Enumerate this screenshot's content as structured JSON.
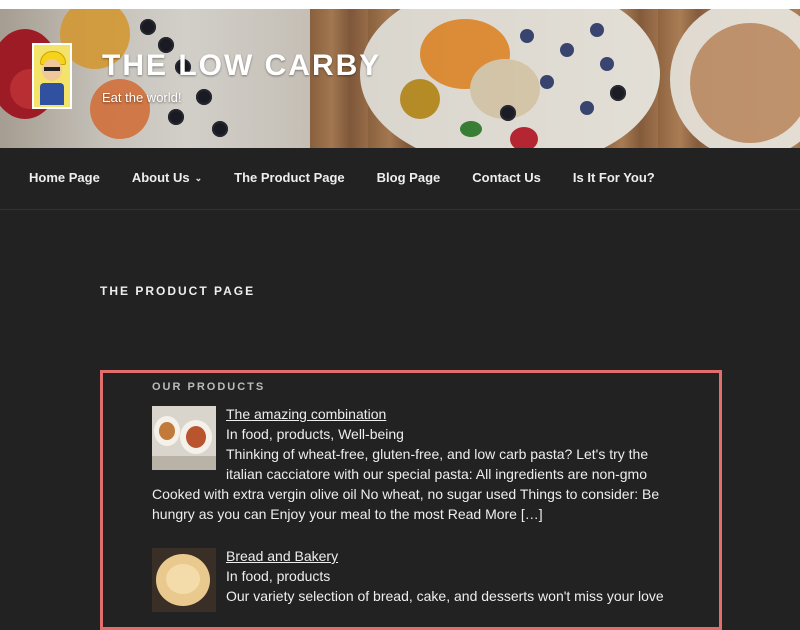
{
  "site": {
    "title": "THE LOW CARBY",
    "tagline": "Eat the world!"
  },
  "nav": {
    "items": [
      {
        "label": "Home Page"
      },
      {
        "label": "About Us"
      },
      {
        "label": "The Product Page"
      },
      {
        "label": "Blog Page"
      },
      {
        "label": "Contact Us"
      },
      {
        "label": "Is It For You?"
      }
    ]
  },
  "page": {
    "title": "THE PRODUCT PAGE"
  },
  "products": {
    "heading": "OUR PRODUCTS",
    "items": [
      {
        "title": "The amazing combination",
        "categories": "In food, products, Well-being",
        "excerpt": "Thinking of wheat-free, gluten-free, and low carb pasta? Let's try the italian cacciatore with our special pasta: All ingredients are non-gmo Cooked with extra vergin olive oil No wheat, no sugar used Things to consider: Be hungry as you can Enjoy your meal to the most Read More […]"
      },
      {
        "title": "Bread and Bakery",
        "categories": "In food, products",
        "excerpt": "Our variety selection of bread, cake, and desserts won't miss your love"
      }
    ]
  },
  "colors": {
    "background": "#222222",
    "accent_border": "#e26d6d",
    "text": "#eeeeee"
  }
}
